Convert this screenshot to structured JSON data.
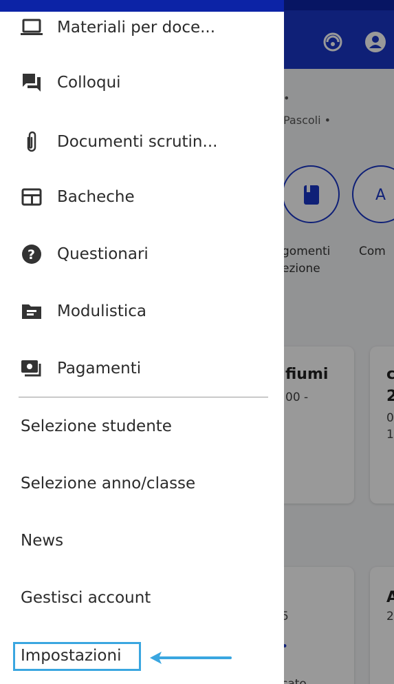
{
  "background": {
    "school_line": "Pascoli •",
    "dot_line": "•",
    "shortcut_1_label_line1": "gomenti",
    "shortcut_1_label_line2": "ezione",
    "shortcut_2_label": "Com",
    "card_1_title": "fiumi",
    "card_1_time": "00 -",
    "card_2_title": "c",
    "card_2_line1": "2",
    "card_2_line2": "0",
    "card_2_line3": "1(",
    "card_3_value": "5",
    "card_3_dot": "•",
    "card_4_title": "A",
    "card_4_value": "2",
    "card_5_partial": "cato",
    "icons": [
      "support-icon",
      "account-icon"
    ]
  },
  "drawer": {
    "items": [
      {
        "label": "Materiali per doce...",
        "icon": "laptop-icon"
      },
      {
        "label": "Colloqui",
        "icon": "chat-icon"
      },
      {
        "label": "Documenti scrutin...",
        "icon": "paperclip-icon"
      },
      {
        "label": "Bacheche",
        "icon": "board-icon"
      },
      {
        "label": "Questionari",
        "icon": "help-icon"
      },
      {
        "label": "Modulistica",
        "icon": "folder-icon"
      },
      {
        "label": "Pagamenti",
        "icon": "payment-icon"
      }
    ],
    "text_items": [
      {
        "label": "Selezione studente"
      },
      {
        "label": "Selezione anno/classe"
      },
      {
        "label": "News"
      },
      {
        "label": "Gestisci account"
      },
      {
        "label": "Impostazioni"
      }
    ]
  },
  "colors": {
    "brand_blue": "#1a36c7",
    "highlight": "#3aa6e0"
  }
}
